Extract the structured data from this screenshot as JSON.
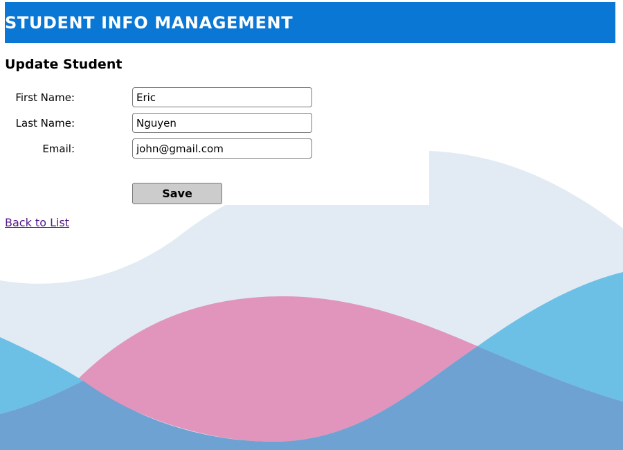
{
  "app": {
    "title": "STUDENT INFO MANAGEMENT",
    "header_color": "#0a77d4"
  },
  "page": {
    "heading": "Update Student"
  },
  "form": {
    "first_name": {
      "label": "First Name:",
      "value": "Eric"
    },
    "last_name": {
      "label": "Last Name:",
      "value": "Nguyen"
    },
    "email": {
      "label": "Email:",
      "value": "john@gmail.com"
    },
    "save_label": "Save"
  },
  "links": {
    "back_label": "Back to List",
    "link_color": "#551a8b"
  },
  "background": {
    "wave_colors": [
      "#e2ebf3",
      "#e195bc",
      "#6cc0e6",
      "#6ea2d2"
    ]
  }
}
